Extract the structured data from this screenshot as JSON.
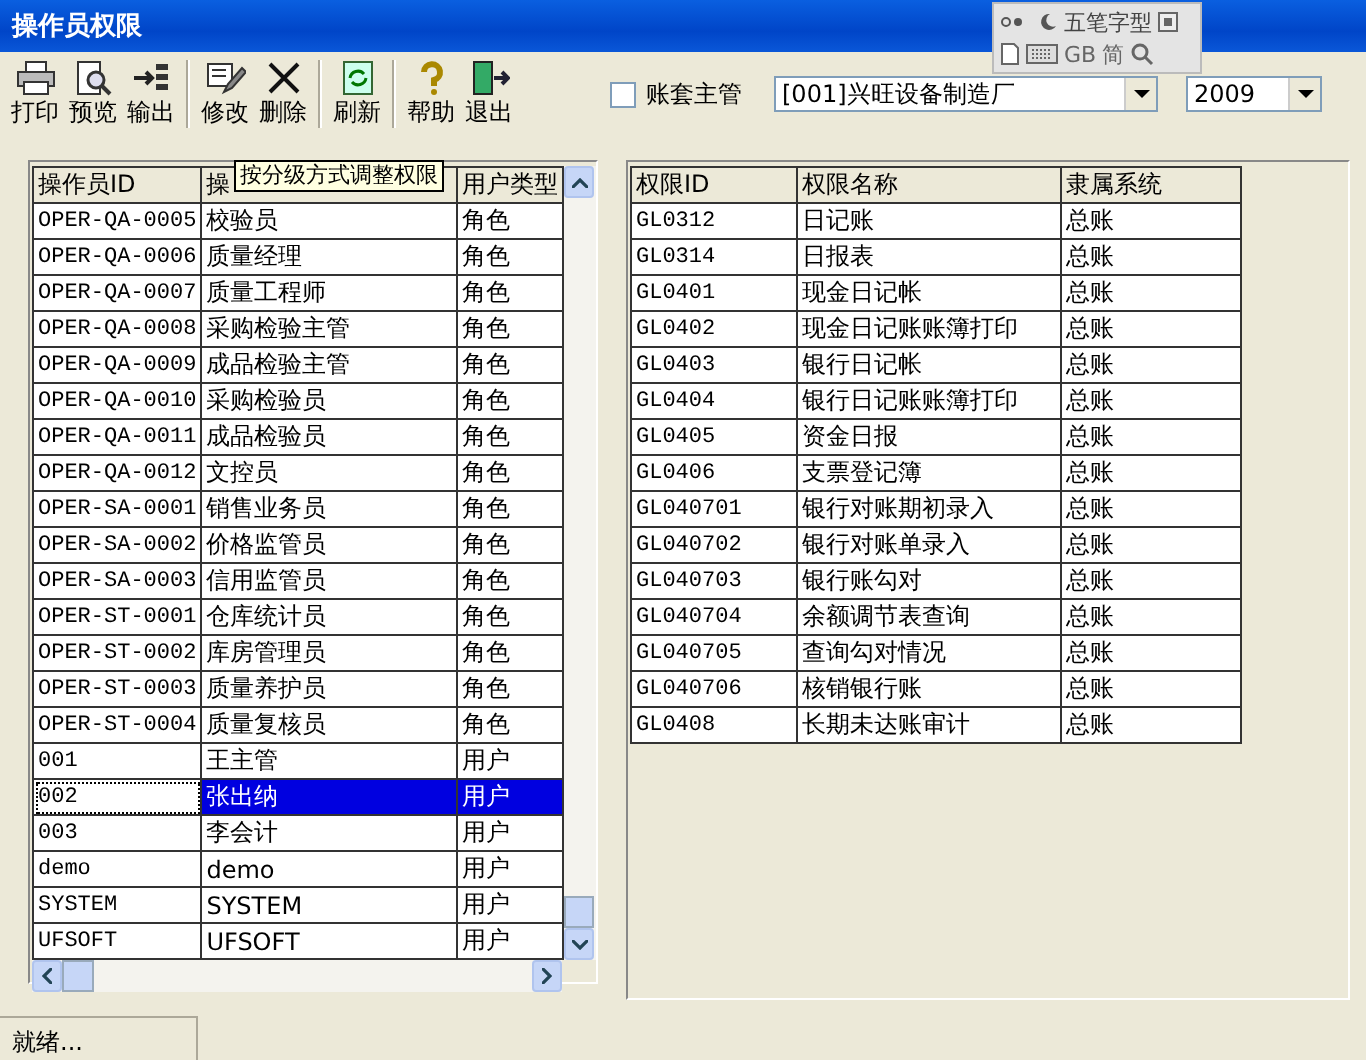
{
  "window": {
    "title": "操作员权限"
  },
  "ime_bar": {
    "label": "五笔字型",
    "mode_1": "GB",
    "mode_2": "简"
  },
  "toolbar": [
    {
      "label": "打印"
    },
    {
      "label": "预览"
    },
    {
      "label": "输出"
    },
    {
      "label": "修改"
    },
    {
      "label": "删除"
    },
    {
      "label": "刷新"
    },
    {
      "label": "帮助"
    },
    {
      "label": "退出"
    }
  ],
  "supervisor_checkbox": {
    "label": "账套主管",
    "checked": false
  },
  "account_select": {
    "value": "[001]兴旺设备制造厂"
  },
  "year_select": {
    "value": "2009"
  },
  "tooltip": "按分级方式调整权限",
  "operators": {
    "columns": [
      "操作员ID",
      "操",
      "用户类型"
    ],
    "rows": [
      {
        "id": "OPER-QA-0005",
        "name": "校验员",
        "type": "角色",
        "selected": false
      },
      {
        "id": "OPER-QA-0006",
        "name": "质量经理",
        "type": "角色",
        "selected": false
      },
      {
        "id": "OPER-QA-0007",
        "name": "质量工程师",
        "type": "角色",
        "selected": false
      },
      {
        "id": "OPER-QA-0008",
        "name": "采购检验主管",
        "type": "角色",
        "selected": false
      },
      {
        "id": "OPER-QA-0009",
        "name": "成品检验主管",
        "type": "角色",
        "selected": false
      },
      {
        "id": "OPER-QA-0010",
        "name": "采购检验员",
        "type": "角色",
        "selected": false
      },
      {
        "id": "OPER-QA-0011",
        "name": "成品检验员",
        "type": "角色",
        "selected": false
      },
      {
        "id": "OPER-QA-0012",
        "name": "文控员",
        "type": "角色",
        "selected": false
      },
      {
        "id": "OPER-SA-0001",
        "name": "销售业务员",
        "type": "角色",
        "selected": false
      },
      {
        "id": "OPER-SA-0002",
        "name": "价格监管员",
        "type": "角色",
        "selected": false
      },
      {
        "id": "OPER-SA-0003",
        "name": "信用监管员",
        "type": "角色",
        "selected": false
      },
      {
        "id": "OPER-ST-0001",
        "name": "仓库统计员",
        "type": "角色",
        "selected": false
      },
      {
        "id": "OPER-ST-0002",
        "name": "库房管理员",
        "type": "角色",
        "selected": false
      },
      {
        "id": "OPER-ST-0003",
        "name": "质量养护员",
        "type": "角色",
        "selected": false
      },
      {
        "id": "OPER-ST-0004",
        "name": "质量复核员",
        "type": "角色",
        "selected": false
      },
      {
        "id": "001",
        "name": "王主管",
        "type": "用户",
        "selected": false
      },
      {
        "id": "002",
        "name": "张出纳",
        "type": "用户",
        "selected": true
      },
      {
        "id": "003",
        "name": "李会计",
        "type": "用户",
        "selected": false
      },
      {
        "id": "demo",
        "name": "demo",
        "type": "用户",
        "selected": false
      },
      {
        "id": "SYSTEM",
        "name": "SYSTEM",
        "type": "用户",
        "selected": false
      },
      {
        "id": "UFSOFT",
        "name": "UFSOFT",
        "type": "用户",
        "selected": false
      }
    ]
  },
  "permissions": {
    "columns": [
      "权限ID",
      "权限名称",
      "隶属系统"
    ],
    "rows": [
      {
        "id": "GL0312",
        "name": "日记账",
        "system": "总账"
      },
      {
        "id": "GL0314",
        "name": "日报表",
        "system": "总账"
      },
      {
        "id": "GL0401",
        "name": "现金日记帐",
        "system": "总账"
      },
      {
        "id": "GL0402",
        "name": "现金日记账账簿打印",
        "system": "总账"
      },
      {
        "id": "GL0403",
        "name": "银行日记帐",
        "system": "总账"
      },
      {
        "id": "GL0404",
        "name": "银行日记账账簿打印",
        "system": "总账"
      },
      {
        "id": "GL0405",
        "name": "资金日报",
        "system": "总账"
      },
      {
        "id": "GL0406",
        "name": "支票登记簿",
        "system": "总账"
      },
      {
        "id": "GL040701",
        "name": "银行对账期初录入",
        "system": "总账"
      },
      {
        "id": "GL040702",
        "name": "银行对账单录入",
        "system": "总账"
      },
      {
        "id": "GL040703",
        "name": "银行账勾对",
        "system": "总账"
      },
      {
        "id": "GL040704",
        "name": "余额调节表查询",
        "system": "总账"
      },
      {
        "id": "GL040705",
        "name": "查询勾对情况",
        "system": "总账"
      },
      {
        "id": "GL040706",
        "name": "核销银行账",
        "system": "总账"
      },
      {
        "id": "GL0408",
        "name": "长期未达账审计",
        "system": "总账"
      }
    ]
  },
  "status_bar": {
    "text": "就绪..."
  }
}
